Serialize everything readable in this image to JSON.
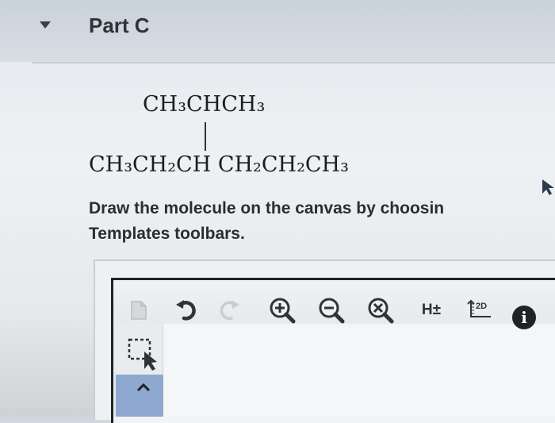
{
  "part": {
    "title": "Part C",
    "toggle_icon": "caret-down-icon"
  },
  "structure": {
    "branch_formula": "CH₃CHCH₃",
    "main_chain_formula": "CH₃CH₂CH CH₂CH₂CH₃"
  },
  "instruction": {
    "line1": "Draw the molecule on the canvas by choosin",
    "line2": "Templates toolbars."
  },
  "editor": {
    "toolbar": {
      "tools": [
        {
          "name": "new-document-icon"
        },
        {
          "name": "undo-icon"
        },
        {
          "name": "redo-icon"
        },
        {
          "name": "zoom-in-icon"
        },
        {
          "name": "zoom-out-icon"
        },
        {
          "name": "reset-zoom-icon"
        },
        {
          "name": "hydrogen-toggle-icon",
          "label": "H±"
        },
        {
          "name": "clean-2d-icon",
          "label": "2D"
        },
        {
          "name": "info-icon",
          "label": "i"
        }
      ]
    },
    "left_toolbar": {
      "tools": [
        {
          "name": "selection-tool-icon"
        },
        {
          "name": "expand-caret-icon"
        }
      ]
    }
  },
  "colors": {
    "text": "#2a2d31",
    "frame": "#1f2226",
    "tab_blue": "#8ea8d0"
  }
}
